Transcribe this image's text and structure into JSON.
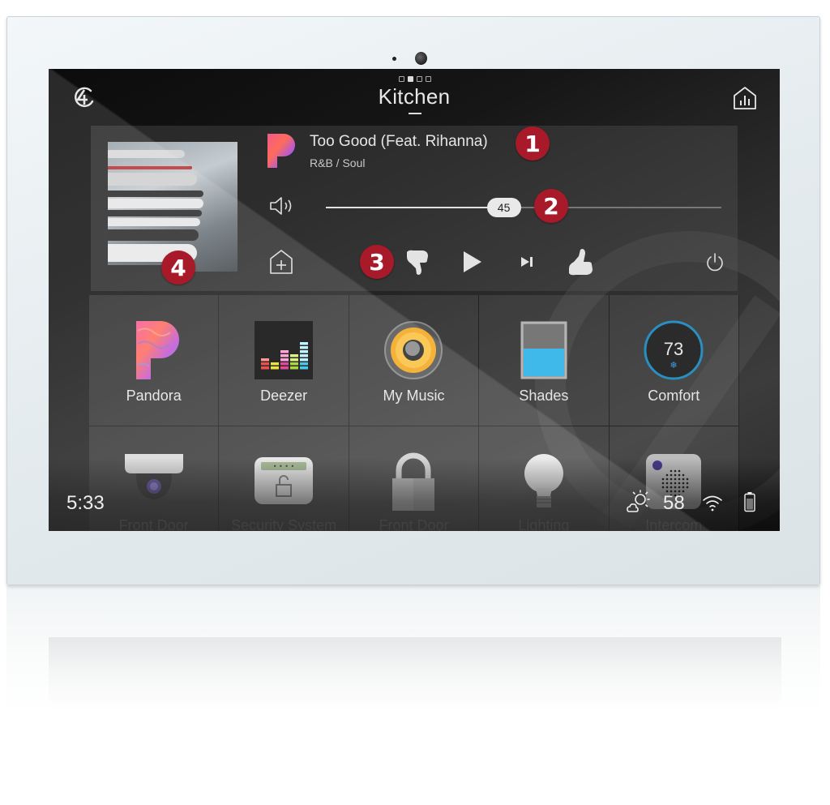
{
  "screen": {
    "room_title": "Kitchen",
    "page_indicator": {
      "count": 4,
      "active_index": 1
    }
  },
  "now_playing": {
    "source": "Pandora",
    "track_title": "Too Good (Feat. Rihanna)",
    "genre": "R&B / Soul",
    "volume": 45,
    "volume_label": "45"
  },
  "controls": {
    "add_room": "add-room",
    "thumbs_down": "thumbs-down",
    "play": "play",
    "next": "next",
    "thumbs_up": "thumbs-up",
    "power": "power"
  },
  "callouts": [
    "1",
    "2",
    "3",
    "4"
  ],
  "tiles": [
    {
      "label": "Pandora",
      "icon": "pandora-icon"
    },
    {
      "label": "Deezer",
      "icon": "deezer-icon"
    },
    {
      "label": "My Music",
      "icon": "speaker-icon"
    },
    {
      "label": "Shades",
      "icon": "shades-icon"
    },
    {
      "label": "Comfort",
      "icon": "thermostat-icon",
      "value": "73"
    },
    {
      "label": "Front Door",
      "icon": "camera-icon"
    },
    {
      "label": "Security System",
      "icon": "security-keypad-icon"
    },
    {
      "label": "Front Door",
      "icon": "lock-icon"
    },
    {
      "label": "Lighting",
      "icon": "light-bulb-icon"
    },
    {
      "label": "Intercom",
      "icon": "intercom-icon"
    }
  ],
  "status_bar": {
    "time": "5:33",
    "outdoor_temp": "58",
    "weather": "partly-sunny"
  },
  "colors": {
    "badge": "#a81a2a",
    "thermostat_ring": "#2a8fc0",
    "shade_blue": "#3fb8ea"
  }
}
